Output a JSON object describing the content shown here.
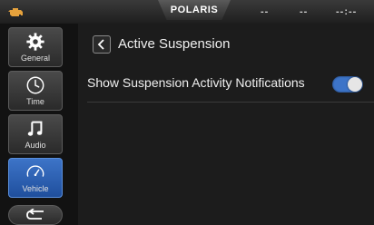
{
  "topbar": {
    "brand": "POLARIS",
    "status_1": "--",
    "status_2": "--",
    "clock": "--:--"
  },
  "sidebar": {
    "items": [
      {
        "label": "General",
        "icon": "gear-icon",
        "active": false
      },
      {
        "label": "Time",
        "icon": "clock-icon",
        "active": false
      },
      {
        "label": "Audio",
        "icon": "music-note-icon",
        "active": false
      },
      {
        "label": "Vehicle",
        "icon": "speedometer-icon",
        "active": true
      }
    ],
    "back_icon": "return-arrow-icon"
  },
  "main": {
    "title": "Active Suspension",
    "settings": [
      {
        "label": "Show Suspension Activity Notifications",
        "enabled": true
      }
    ]
  },
  "colors": {
    "accent": "#3d74c8",
    "warning": "#e6a23c",
    "background": "#1c1c1c"
  }
}
